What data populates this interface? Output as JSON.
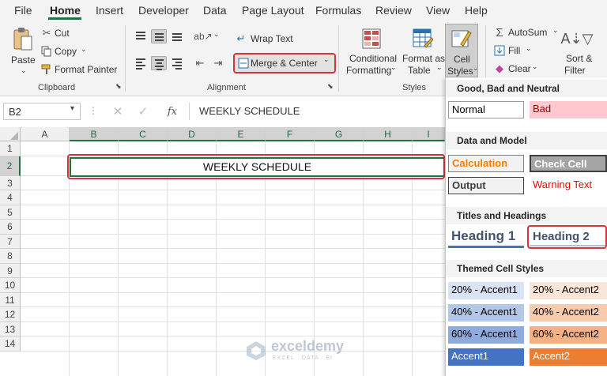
{
  "menu": {
    "items": [
      "File",
      "Home",
      "Insert",
      "Developer",
      "Data",
      "Page Layout",
      "Formulas",
      "Review",
      "View",
      "Help"
    ]
  },
  "clipboard": {
    "paste": "Paste",
    "cut": "Cut",
    "copy": "Copy",
    "format_painter": "Format Painter",
    "group": "Clipboard"
  },
  "alignment": {
    "wrap_text": "Wrap Text",
    "merge_center": "Merge & Center",
    "group": "Alignment"
  },
  "styles": {
    "conditional_formatting": [
      "Conditional",
      "Formatting"
    ],
    "format_as_table": [
      "Format as",
      "Table"
    ],
    "cell_styles": [
      "Cell",
      "Styles"
    ],
    "group": "Styles"
  },
  "editing": {
    "autosum": "AutoSum",
    "fill": "Fill",
    "clear": "Clear",
    "sort_filter": [
      "Sort &",
      "Filter"
    ]
  },
  "formula_bar": {
    "name_box": "B2",
    "fx": "fx",
    "content": "WEEKLY SCHEDULE"
  },
  "grid": {
    "columns": [
      "A",
      "B",
      "C",
      "D",
      "E",
      "F",
      "G",
      "H",
      "I"
    ],
    "rows": [
      "1",
      "2",
      "3",
      "4",
      "5",
      "6",
      "7",
      "8",
      "9",
      "10",
      "11",
      "12",
      "13",
      "14"
    ],
    "merged_cell_text": "WEEKLY SCHEDULE"
  },
  "cell_styles_panel": {
    "good_bad_neutral": "Good, Bad and Neutral",
    "normal": "Normal",
    "bad": "Bad",
    "data_model": "Data and Model",
    "calculation": "Calculation",
    "check_cell": "Check Cell",
    "output": "Output",
    "warning_text": "Warning Text",
    "titles_headings": "Titles and Headings",
    "heading1": "Heading 1",
    "heading2": "Heading 2",
    "themed": "Themed Cell Styles",
    "themed_items": [
      [
        "20% - Accent1",
        "20% - Accent2"
      ],
      [
        "40% - Accent1",
        "40% - Accent2"
      ],
      [
        "60% - Accent1",
        "60% - Accent2"
      ],
      [
        "Accent1",
        "Accent2"
      ]
    ]
  },
  "watermark": {
    "name": "exceldemy",
    "tagline": "EXCEL · DATA · BI"
  },
  "colors": {
    "excel_green": "#217346",
    "highlight_red": "#d6353a"
  }
}
